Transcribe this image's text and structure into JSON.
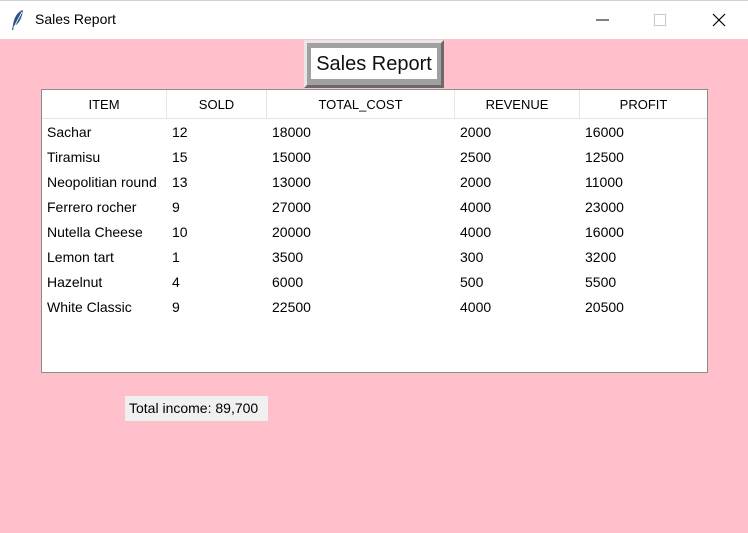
{
  "window": {
    "title": "Sales Report"
  },
  "report": {
    "heading": "Sales Report"
  },
  "table": {
    "headers": [
      "ITEM",
      "SOLD",
      "TOTAL_COST",
      "REVENUE",
      "PROFIT"
    ],
    "rows": [
      [
        "Sachar",
        "12",
        "18000",
        "2000",
        "16000"
      ],
      [
        "Tiramisu",
        "15",
        "15000",
        "2500",
        "12500"
      ],
      [
        "Neopolitian round",
        "13",
        "13000",
        "2000",
        "11000"
      ],
      [
        "Ferrero rocher",
        "9",
        "27000",
        "4000",
        "23000"
      ],
      [
        "Nutella Cheese",
        "10",
        "20000",
        "4000",
        "16000"
      ],
      [
        "Lemon tart",
        "1",
        "3500",
        "300",
        "3200"
      ],
      [
        "Hazelnut",
        "4",
        "6000",
        "500",
        "5500"
      ],
      [
        "White Classic",
        "9",
        "22500",
        "4000",
        "20500"
      ]
    ]
  },
  "summary": {
    "total_income": "Total income: 89,700"
  },
  "colors": {
    "background": "#ffc0cb",
    "table": "#ffffff",
    "label_border": "#a0a0a0"
  },
  "icons": {
    "app": "feather-icon",
    "minimize": "minimize-icon",
    "maximize": "maximize-icon",
    "close": "close-icon"
  }
}
